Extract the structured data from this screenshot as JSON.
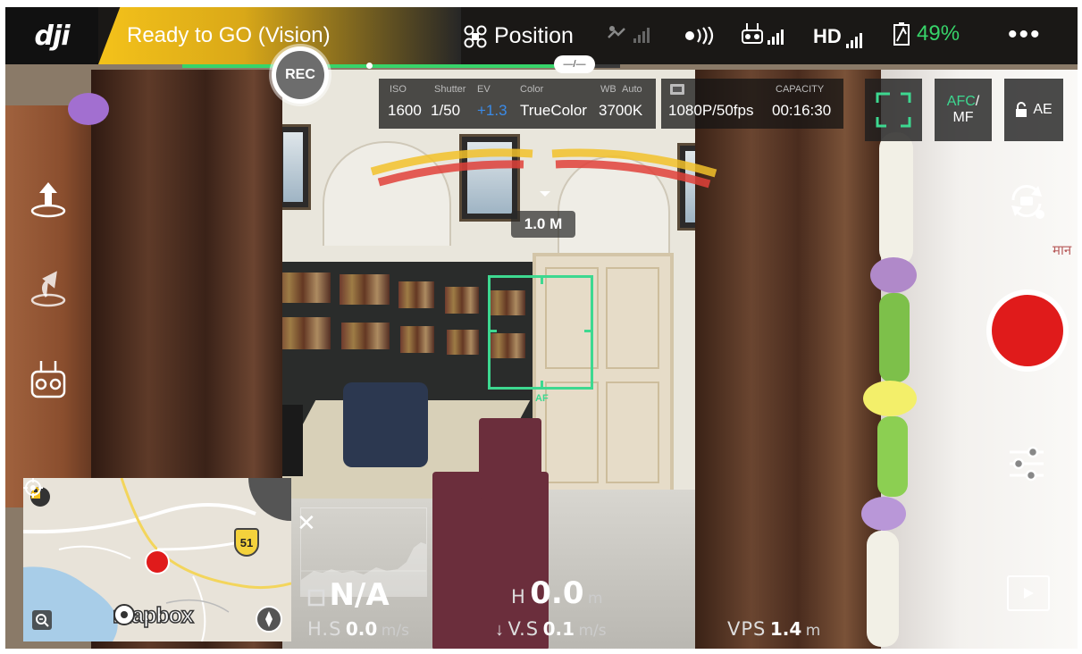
{
  "top_bar": {
    "brand": "dji",
    "status": "Ready to GO (Vision)",
    "flight_mode": "Position",
    "hd_label": "HD",
    "battery": "49%",
    "more": "•••",
    "progress_label": "—/—",
    "progress": 0.85
  },
  "rec_badge": "REC",
  "camera": {
    "iso_label": "ISO",
    "iso": "1600",
    "shutter_label": "Shutter",
    "shutter": "1/50",
    "ev_label": "EV",
    "ev": "+1.3",
    "color_label": "Color",
    "color": "TrueColor",
    "wb_label": "WB",
    "wb_mode": "Auto",
    "wb": "3700K",
    "capacity_label": "CAPACITY",
    "resolution": "1080P/50fps",
    "capacity": "00:16:30"
  },
  "focus": {
    "afc": "AFC",
    "slash": "/",
    "mf": "MF",
    "ae": "AE"
  },
  "overlay": {
    "distance": "1.0 M",
    "af_label": "AF"
  },
  "map": {
    "route_number": "51",
    "attribution": "mapbox"
  },
  "telemetry": {
    "d_value": "N/A",
    "h_label": "H",
    "h_value": "0.0",
    "h_unit": "m",
    "hs_label": "H.S",
    "hs_value": "0.0",
    "hs_unit": "m/s",
    "vs_label": "V.S",
    "vs_value": "0.1",
    "vs_unit": "m/s",
    "vps_label": "VPS",
    "vps_value": "1.4",
    "vps_unit": "m"
  },
  "scene": {
    "hindi_text": "मान"
  },
  "colors": {
    "accent_green": "#37d46a",
    "af_green": "#3dd890",
    "record_red": "#e01b1b",
    "status_yellow": "#f4c21a",
    "ev_blue": "#3a8be8"
  },
  "icons": [
    "dji-logo",
    "drone-icon",
    "gps-signal-icon",
    "vision-signal-icon",
    "remote-signal-icon",
    "hd-signal-icon",
    "battery-icon",
    "takeoff-icon",
    "return-home-icon",
    "flight-mode-icon",
    "camera-switch-icon",
    "settings-sliders-icon",
    "playback-icon",
    "lock-icon",
    "locate-icon",
    "zoom-out-icon",
    "compass-icon"
  ]
}
